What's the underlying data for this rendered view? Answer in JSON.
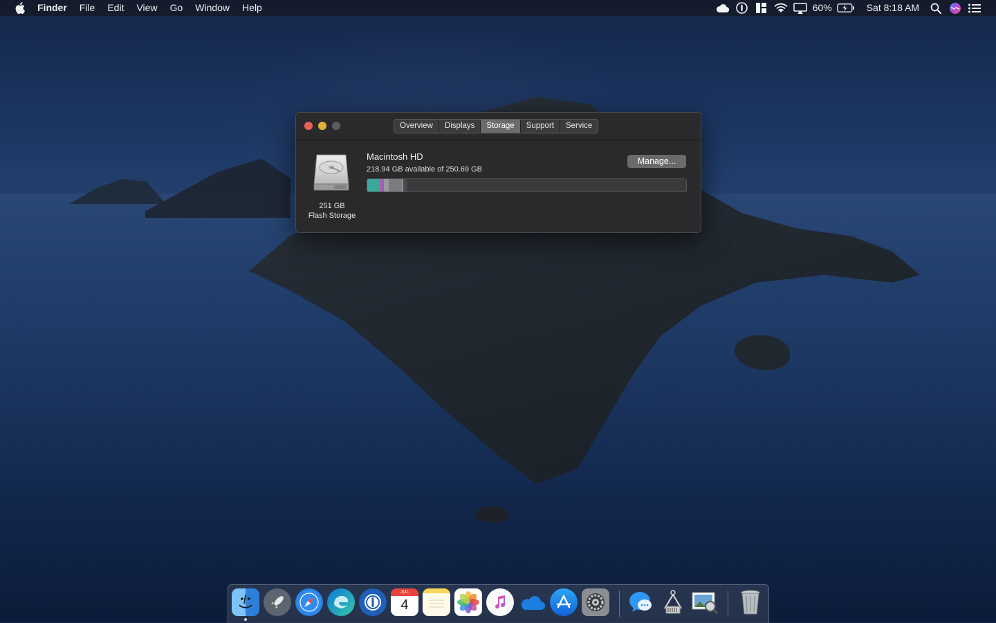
{
  "menubar": {
    "app_name": "Finder",
    "menus": [
      "File",
      "Edit",
      "View",
      "Go",
      "Window",
      "Help"
    ],
    "battery": "60%",
    "clock": "Sat 8:18 AM",
    "status_icons": [
      "cloud-icon",
      "onepassword-icon",
      "grid-icon",
      "wifi-icon",
      "airplay-icon",
      "battery-icon",
      "search-icon",
      "siri-icon",
      "notification-center-icon"
    ]
  },
  "window": {
    "tabs": [
      "Overview",
      "Displays",
      "Storage",
      "Support",
      "Service"
    ],
    "active_tab": "Storage",
    "disk": {
      "capacity": "251 GB",
      "type": "Flash Storage"
    },
    "volume": {
      "name": "Macintosh HD",
      "availability": "218.94 GB available of 250.69 GB",
      "used_fraction": 0.127
    },
    "manage_label": "Manage..."
  },
  "dock": {
    "apps": [
      "Finder",
      "Launchpad",
      "Safari",
      "Microsoft Edge",
      "1Password",
      "Calendar",
      "Notes",
      "Photos",
      "iTunes",
      "OneDrive",
      "App Store",
      "System Preferences",
      "Messenger",
      "System Information",
      "Preview",
      "Trash"
    ],
    "calendar": {
      "month": "JUL",
      "day": "4"
    }
  },
  "colors": {
    "close": "#ec5f57",
    "minimize": "#e0b136",
    "zoom_disabled": "#5b5b5d",
    "storage_apps": "#3aa89a",
    "storage_docs": "#c85c9e",
    "storage_photos": "#8a65c5",
    "storage_system": "#9a9a9d"
  }
}
